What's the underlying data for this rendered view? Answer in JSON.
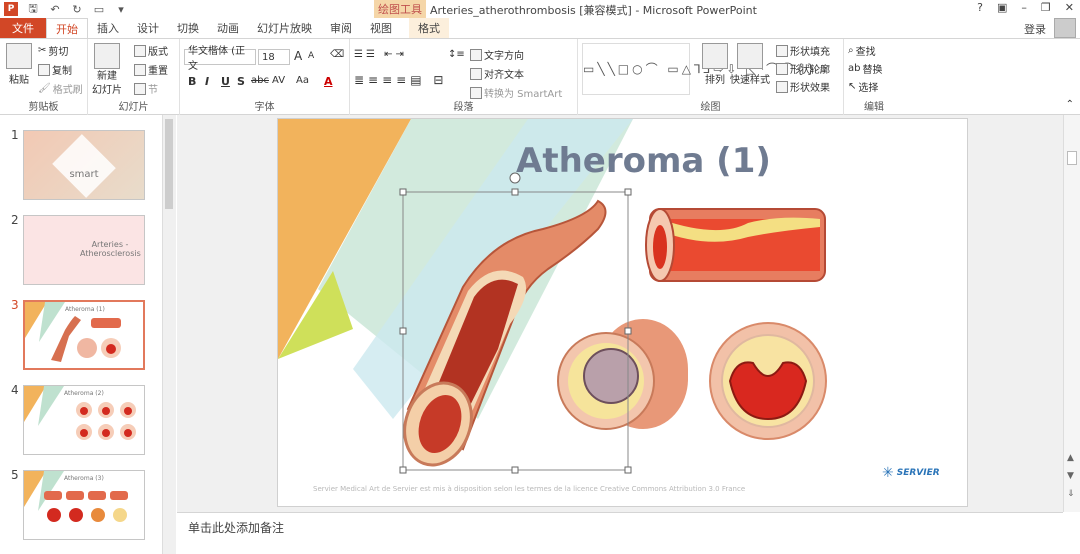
{
  "titlebar": {
    "context_tools": "绘图工具",
    "doc_title": "Arteries_atherothrombosis [兼容模式] - Microsoft PowerPoint",
    "help": "?",
    "controls": [
      "▣",
      "–",
      "❐",
      "✕"
    ]
  },
  "tabs": {
    "file": "文件",
    "items": [
      "开始",
      "插入",
      "设计",
      "切换",
      "动画",
      "幻灯片放映",
      "审阅",
      "视图",
      "格式"
    ],
    "active": "开始",
    "login": "登录"
  },
  "ribbon": {
    "clipboard": {
      "label": "剪贴板",
      "paste": "粘贴",
      "cut": "剪切",
      "copy": "复制",
      "painter": "格式刷"
    },
    "slides": {
      "label": "幻灯片",
      "new_slide": "新建",
      "new_slide2": "幻灯片",
      "layout": "版式",
      "reset": "重置",
      "section": "节"
    },
    "font": {
      "label": "字体",
      "name": "华文楷体 (正文",
      "size": "18",
      "bold": "B",
      "italic": "I",
      "underline": "U",
      "shadow": "S",
      "strike": "abc",
      "spacing": "AV",
      "case": "Aa",
      "color": "A",
      "grow": "A",
      "shrink": "A"
    },
    "paragraph": {
      "label": "段落",
      "text_dir": "文字方向",
      "align_text": "对齐文本",
      "smartart": "转换为 SmartArt"
    },
    "drawing": {
      "label": "绘图",
      "arrange": "排列",
      "quick_styles": "快速样式",
      "fill": "形状填充",
      "outline": "形状轮廓",
      "effects": "形状效果"
    },
    "editing": {
      "label": "编辑",
      "find": "查找",
      "replace": "替换",
      "select": "选择"
    }
  },
  "thumbnails": [
    {
      "num": "1",
      "text": "smart"
    },
    {
      "num": "2",
      "text": "Arteries - Atherosclerosis"
    },
    {
      "num": "3",
      "text": "Atheroma (1)"
    },
    {
      "num": "4",
      "text": "Atheroma (2)"
    },
    {
      "num": "5",
      "text": "Atheroma (3)"
    }
  ],
  "slide": {
    "title": "Atheroma (1)",
    "credit": "Servier Medical Art de Servier est mis à disposition selon les termes de la licence Creative Commons Attribution 3.0 France",
    "logo": "SERVIER"
  },
  "notes": {
    "placeholder": "单击此处添加备注"
  },
  "colors": {
    "accent": "#d24726",
    "title": "#6f7b91"
  }
}
